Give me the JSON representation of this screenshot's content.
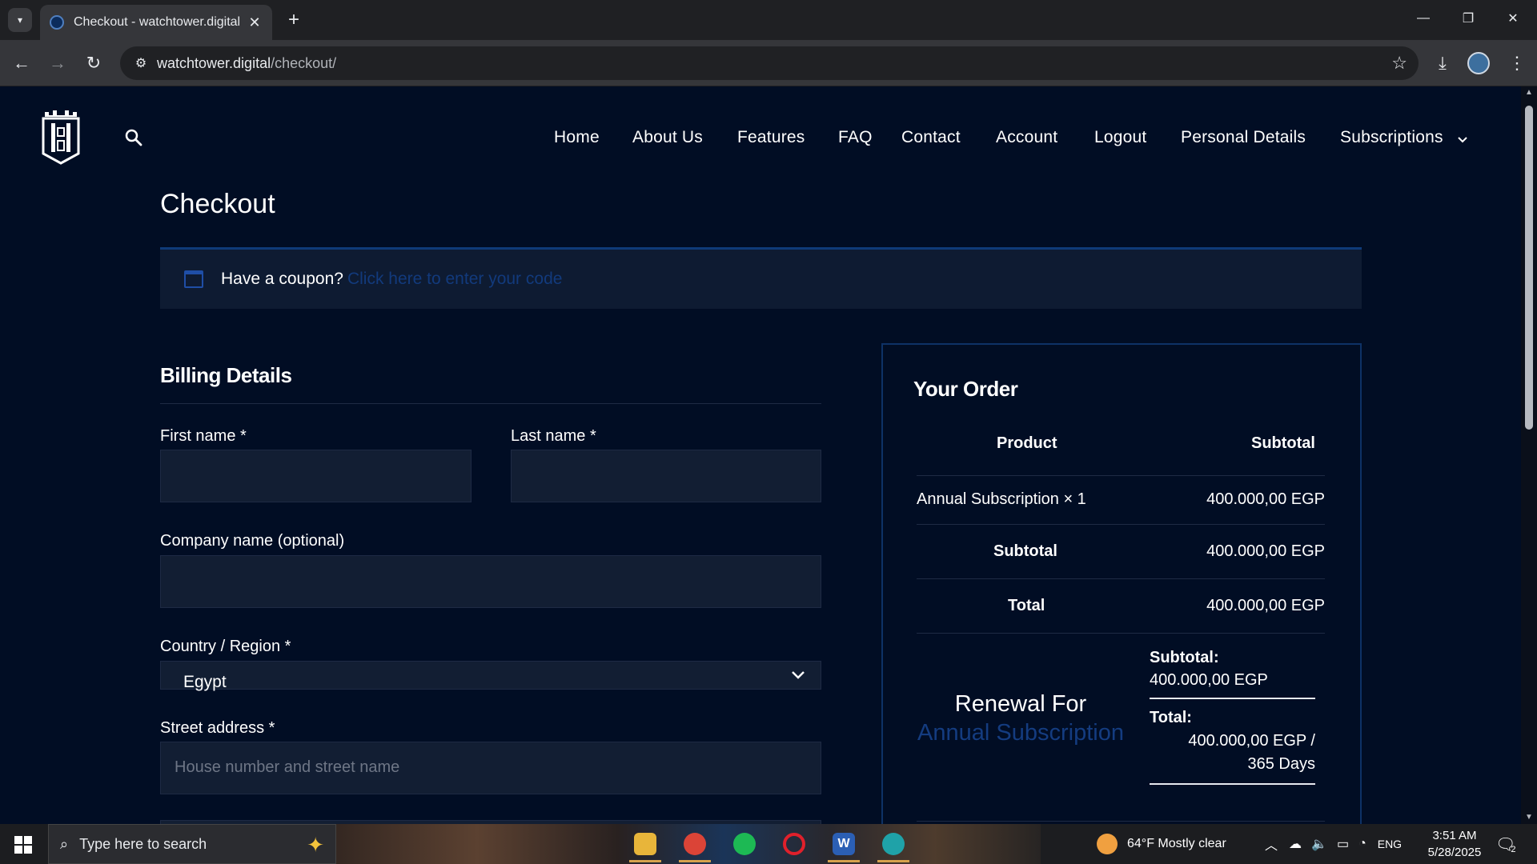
{
  "browser": {
    "tab_title": "Checkout - watchtower.digital",
    "tab_close": "✕",
    "new_tab": "+",
    "url_domain": "watchtower.digital",
    "url_path": "/checkout/",
    "minimize": "—",
    "maximize": "❐",
    "close": "✕"
  },
  "nav": {
    "items": [
      "Home",
      "About Us",
      "Features",
      "FAQ",
      "Contact",
      "Account",
      "Logout",
      "Personal Details",
      "Subscriptions"
    ]
  },
  "page": {
    "title": "Checkout",
    "coupon_text": "Have a coupon?",
    "coupon_link": "Click here to enter your code"
  },
  "billing": {
    "title": "Billing Details",
    "first_name_label": "First name *",
    "last_name_label": "Last name *",
    "company_label": "Company name (optional)",
    "country_label": "Country / Region *",
    "country_value": "Egypt",
    "street_label": "Street address *",
    "street_placeholder": "House number and street name"
  },
  "order": {
    "title": "Your Order",
    "col_product": "Product",
    "col_subtotal": "Subtotal",
    "item_name": "Annual Subscription × 1",
    "item_price": "400.000,00 EGP",
    "subtotal_label": "Subtotal",
    "subtotal_value": "400.000,00 EGP",
    "total_label": "Total",
    "total_value": "400.000,00 EGP",
    "renewal_prefix": "Renewal For",
    "renewal_product": "Annual Subscription",
    "renewal_subtotal_label": "Subtotal:",
    "renewal_subtotal_value": "400.000,00 EGP",
    "renewal_total_label": "Total:",
    "renewal_total_value_line1": "400.000,00 EGP /",
    "renewal_total_value_line2": "365 Days"
  },
  "taskbar": {
    "search_placeholder": "Type here to search",
    "weather": "64°F  Mostly clear",
    "language": "ENG",
    "time": "3:51 AM",
    "date": "5/28/2025",
    "notifications": "2"
  },
  "colors": {
    "page_bg": "#010d24",
    "accent_link": "#123a7c",
    "input_bg": "#121e33"
  }
}
